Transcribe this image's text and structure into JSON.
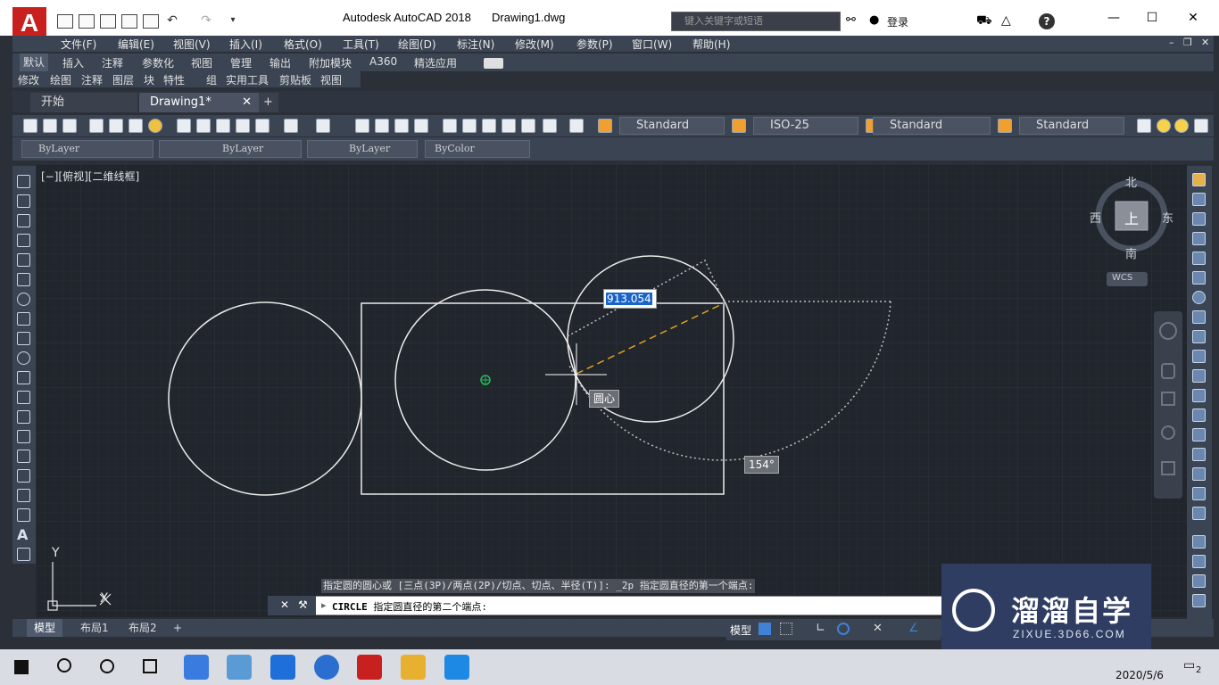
{
  "window": {
    "app_title": "Autodesk AutoCAD 2018",
    "file_title": "Drawing1.dwg",
    "search_placeholder": "键入关键字或短语",
    "login_label": "登录",
    "logo": "A"
  },
  "menu": [
    "文件(F)",
    "编辑(E)",
    "视图(V)",
    "插入(I)",
    "格式(O)",
    "工具(T)",
    "绘图(D)",
    "标注(N)",
    "修改(M)",
    "参数(P)",
    "窗口(W)",
    "帮助(H)"
  ],
  "ribbon_tabs": [
    "默认",
    "插入",
    "注释",
    "参数化",
    "视图",
    "管理",
    "输出",
    "附加模块",
    "A360",
    "精选应用"
  ],
  "panel_tabs": [
    "修改",
    "绘图",
    "注释",
    "图层",
    "块",
    "特性",
    "组",
    "实用工具",
    "剪贴板",
    "视图"
  ],
  "doc_tabs": {
    "start": "开始",
    "active": "Drawing1*"
  },
  "styles": {
    "text_style": "Standard",
    "dim_style": "ISO-25",
    "table_style": "Standard",
    "multileader_style": "Standard"
  },
  "properties": {
    "layer": "ByLayer",
    "linetype": "ByLayer",
    "lineweight": "ByLayer",
    "plot_style": "ByColor"
  },
  "viewport_label": "[−][俯视][二维线框]",
  "viewcube": {
    "north": "北",
    "south": "南",
    "east": "东",
    "west": "西",
    "top": "上",
    "wcs": "WCS"
  },
  "ucs": {
    "x_label": "X",
    "y_label": "Y"
  },
  "dynamic_input": {
    "distance": "913.054",
    "snap_tooltip": "圆心",
    "angle": "154°"
  },
  "command": {
    "history": "指定圆的圆心或 [三点(3P)/两点(2P)/切点、切点、半径(T)]: _2p 指定圆直径的第一个端点:",
    "current_cmd": "CIRCLE",
    "prompt": "指定圆直径的第二个端点:"
  },
  "layout_tabs": [
    "模型",
    "布局1",
    "布局2"
  ],
  "status": {
    "model_label": "模型"
  },
  "watermark": {
    "title": "溜溜自学",
    "url": "ZIXUE.3D66.COM"
  },
  "taskbar": {
    "date": "2020/5/6",
    "notifications": "2"
  },
  "colors": {
    "canvas": "#21252c",
    "ui_dark": "#3b4453",
    "acad_red": "#c8201e",
    "tracking_line": "#e0a020",
    "watermark_bg": "#2f3d63"
  }
}
